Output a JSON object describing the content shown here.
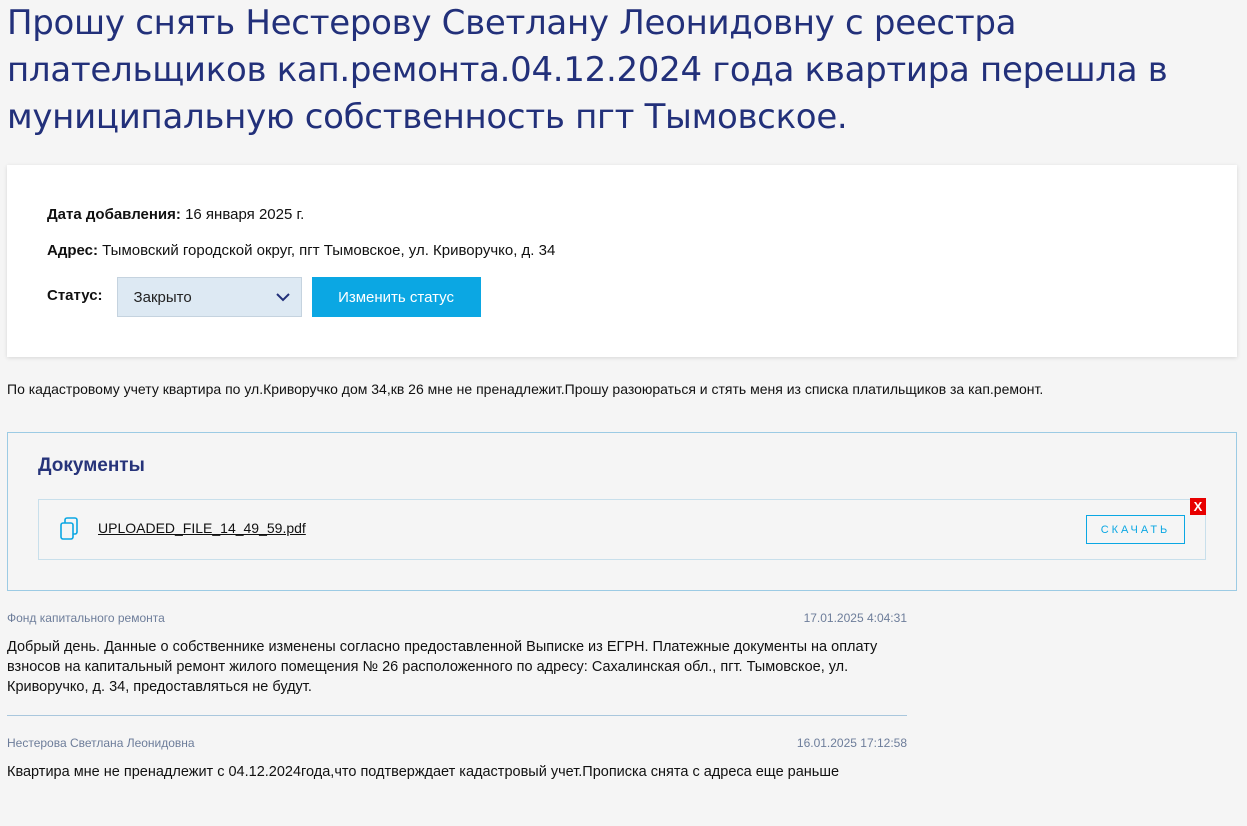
{
  "page": {
    "title": "Прошу снять Нестерову Светлану Леонидовну с реестра плательщиков кап.ремонта.04.12.2024 года квартира перешла в муниципальную собственность пгт Тымовское."
  },
  "info": {
    "date_label": "Дата добавления:",
    "date_value": "16 января 2025 г.",
    "address_label": "Адрес:",
    "address_value": "Тымовский городской округ, пгт Тымовское, ул. Криворучко, д. 34",
    "status_label": "Статус:",
    "status_value": "Закрыто",
    "change_status_label": "Изменить статус"
  },
  "description": "По кадастровому учету квартира по ул.Криворучко дом 34,кв 26 мне не пренадлежит.Прошу разоюраться и стять меня из списка платильщиков за кап.ремонт.",
  "documents": {
    "title": "Документы",
    "items": [
      {
        "filename": "UPLOADED_FILE_14_49_59.pdf",
        "download_label": "СКАЧАТЬ",
        "delete_label": "X"
      }
    ]
  },
  "comments": [
    {
      "author": "Фонд капитального ремонта",
      "time": "17.01.2025 4:04:31",
      "text": "Добрый день. Данные о собственнике изменены согласно предоставленной Выписке из ЕГРН. Платежные документы на оплату взносов на капитальный ремонт жилого помещения № 26 расположенного по адресу: Сахалинская обл., пгт. Тымовское, ул. Криворучко, д. 34, предоставляться не будут."
    },
    {
      "author": "Нестерова Светлана Леонидовна",
      "time": "16.01.2025 17:12:58",
      "text": "Квартира мне не пренадлежит с 04.12.2024года,что подтверждает кадастровый учет.Прописка снята с адреса еще раньше"
    }
  ],
  "colors": {
    "title": "#22307a",
    "accent": "#0ba7e3",
    "delete": "#e80000"
  },
  "icons": [
    "chevron-down-icon",
    "file-copy-icon"
  ]
}
